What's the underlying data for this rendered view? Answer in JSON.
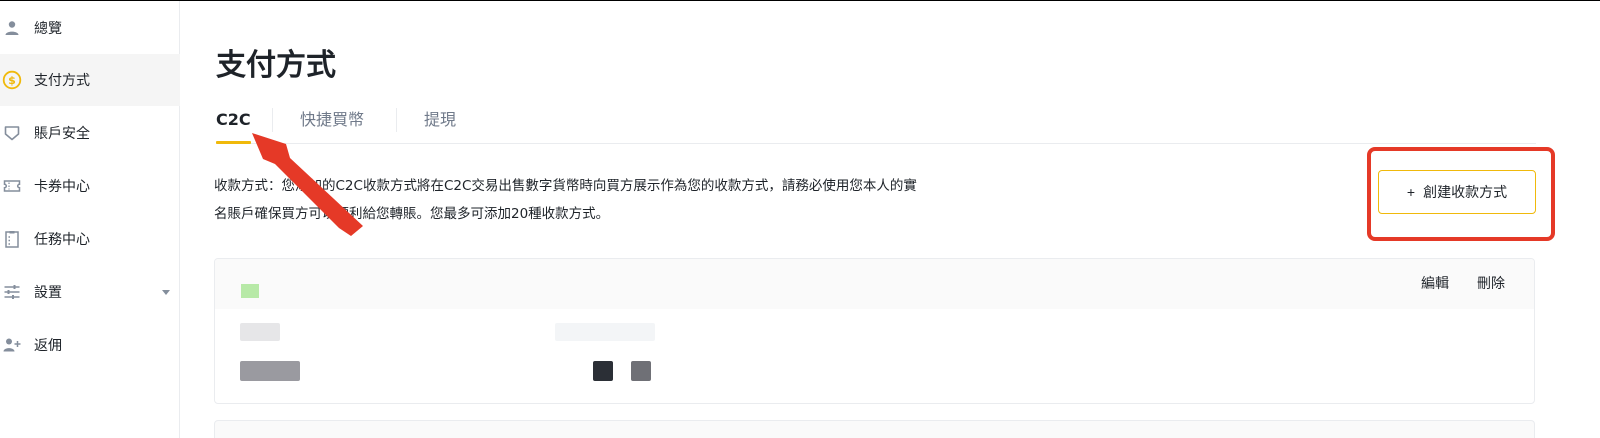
{
  "sidebar": {
    "items": [
      {
        "label": "總覽",
        "icon": "user-icon"
      },
      {
        "label": "支付方式",
        "icon": "dollar-coin-icon",
        "active": true
      },
      {
        "label": "賬戶安全",
        "icon": "shield-icon"
      },
      {
        "label": "卡券中心",
        "icon": "ticket-icon"
      },
      {
        "label": "任務中心",
        "icon": "task-list-icon"
      },
      {
        "label": "設置",
        "icon": "sliders-icon",
        "has_caret": true
      },
      {
        "label": "返佣",
        "icon": "add-user-icon"
      }
    ]
  },
  "page": {
    "title": "支付方式"
  },
  "tabs": [
    {
      "label": "C2C",
      "active": true
    },
    {
      "label": "快捷買幣"
    },
    {
      "label": "提現"
    }
  ],
  "description": {
    "line1": "收款方式：您添加的C2C收款方式將在C2C交易出售數字貨幣時向買方展示作為您的收款方式，請務必使用您本人的實",
    "line2": "名賬戶確保買方可以順利給您轉賬。您最多可添加20種收款方式。"
  },
  "create_button": {
    "plus": "+",
    "label": "創建收款方式"
  },
  "payment_card": {
    "edit_label": "編輯",
    "delete_label": "刪除"
  },
  "colors": {
    "accent": "#f0b90b",
    "highlight_red": "#e53927",
    "text_primary": "#1e2329",
    "text_secondary": "#707a8a"
  }
}
